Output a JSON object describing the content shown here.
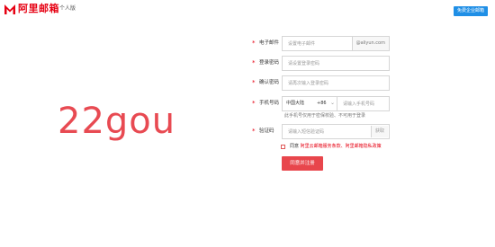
{
  "header": {
    "brand": "阿里邮箱",
    "brand_sub": "个人版",
    "free_button": "免费企业邮箱"
  },
  "hero_text": "22gou",
  "form": {
    "email": {
      "label": "电子邮件",
      "placeholder": "设置电子邮件",
      "suffix": "@aliyun.com"
    },
    "password": {
      "label": "登录密码",
      "placeholder": "请设置登录密码"
    },
    "confirm": {
      "label": "确认密码",
      "placeholder": "请再次输入登录密码"
    },
    "phone": {
      "label": "手机号码",
      "region": "中国大陆",
      "code": "+86",
      "placeholder": "请输入手机号码",
      "hint": "此手机号仅用于密保校验、不可用于登录"
    },
    "captcha": {
      "label": "验证码",
      "placeholder": "请输入短信验证码",
      "button": "获取"
    },
    "agree": {
      "prefix": "同意",
      "link1": "阿里云邮箱服务条款",
      "sep": "、",
      "link2": "阿里邮箱隐私政策"
    },
    "submit": "同意并注册"
  },
  "colors": {
    "brand_red": "#e60012",
    "hero": "#e84a52",
    "button_red": "#e8464c",
    "blue": "#1f8fe6"
  }
}
